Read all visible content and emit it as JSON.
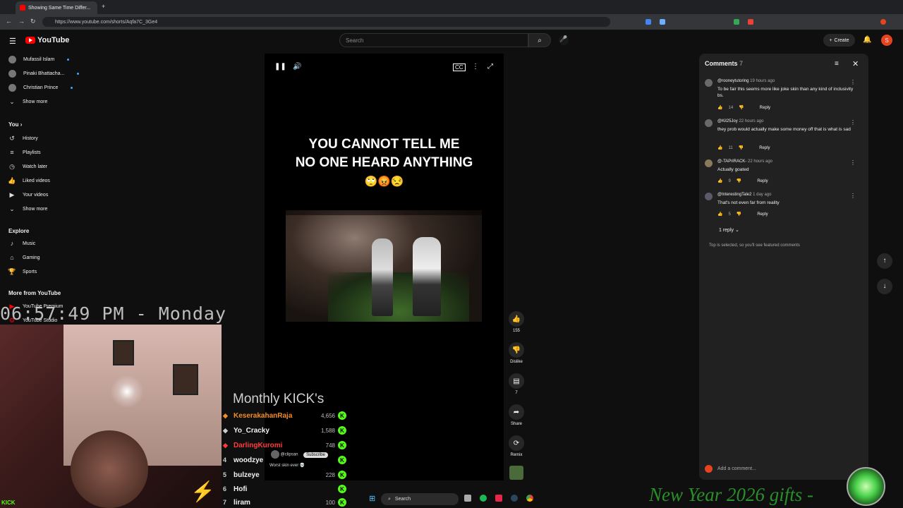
{
  "browser": {
    "tab_title": "Showing Same Time Differ...",
    "url": "https://www.youtube.com/shorts/Aqfa7C_3Ge4"
  },
  "header": {
    "logo": "YouTube",
    "search_placeholder": "Search",
    "create_label": "Create",
    "avatar_letter": "S"
  },
  "sidebar": {
    "subscriptions": [
      {
        "label": "Mufassil Islam"
      },
      {
        "label": "Pinaki Bhattacha..."
      },
      {
        "label": "Christian Prince"
      }
    ],
    "show_more_1": "Show more",
    "you_heading": "You",
    "you_items": [
      {
        "label": "History",
        "icon": "history-icon"
      },
      {
        "label": "Playlists",
        "icon": "playlists-icon"
      },
      {
        "label": "Watch later",
        "icon": "watch-later-icon"
      },
      {
        "label": "Liked videos",
        "icon": "like-icon"
      },
      {
        "label": "Your videos",
        "icon": "video-icon"
      }
    ],
    "show_more_2": "Show more",
    "explore_heading": "Explore",
    "explore_items": [
      {
        "label": "Music",
        "icon": "music-icon"
      },
      {
        "label": "Gaming",
        "icon": "gaming-icon"
      },
      {
        "label": "Sports",
        "icon": "sports-icon"
      }
    ],
    "more_heading": "More from YouTube",
    "more_items": [
      {
        "label": "YouTube Premium"
      },
      {
        "label": "YouTube Studio"
      }
    ]
  },
  "video": {
    "headline_1": "YOU CANNOT TELL ME",
    "headline_2": "NO ONE HEARD ANYTHING",
    "emojis": "🙄😡😒"
  },
  "actions": {
    "likes": "155",
    "dislike": "Dislike",
    "comments": "7",
    "share": "Share",
    "remix": "Remix"
  },
  "comments": {
    "title": "Comments",
    "count": "7",
    "items": [
      {
        "author": "@rooneytutoring",
        "time": "19 hours ago",
        "text": "To be fair this seems more like joke skin than any kind of inclusivity bs.",
        "likes": "14",
        "reply": "Reply"
      },
      {
        "author": "@Kil25Joy",
        "time": "22 hours ago",
        "text": "they prob would actually make some money off that is what is sad",
        "likes": "11",
        "reply": "Reply"
      },
      {
        "author": "@-TAPriRACK-",
        "time": "22 hours ago",
        "text": "Actually goated",
        "likes": "9",
        "reply": "Reply"
      },
      {
        "author": "@InterestingTale2",
        "time": "1 day ago",
        "text": "That's not even far from reality",
        "likes": "5",
        "reply": "Reply"
      }
    ],
    "replies_label": "1 reply",
    "notice": "Top is selected, so you'll see featured comments",
    "add_placeholder": "Add a comment..."
  },
  "overlay": {
    "clock": "06:57:49 PM - Monday",
    "kick_title": "Monthly KICK's",
    "kick_brand": "KICK",
    "leaderboard": [
      {
        "rank": "",
        "name": "KeserakahanRaja",
        "points": "4,656",
        "color": "#f28c28"
      },
      {
        "rank": "",
        "name": "Yo_Cracky",
        "points": "1,588",
        "color": "#e8e8e8"
      },
      {
        "rank": "",
        "name": "DarlingKuromi",
        "points": "748",
        "color": "#ff3b3b"
      },
      {
        "rank": "4",
        "name": "woodzye",
        "points": "",
        "color": "#e8e8e8"
      },
      {
        "rank": "5",
        "name": "bulzeye",
        "points": "228",
        "color": "#e8e8e8"
      },
      {
        "rank": "6",
        "name": "Hofi",
        "points": "",
        "color": "#e8e8e8"
      },
      {
        "rank": "7",
        "name": "liram",
        "points": "100",
        "color": "#e8e8e8"
      }
    ],
    "gifts_text": "New Year 2026 gifts -",
    "channel_handle": "@clipsan",
    "subscribe_label": "Subscribe",
    "short_caption": "Worst skin ever 💀",
    "taskbar_search": "Search"
  }
}
